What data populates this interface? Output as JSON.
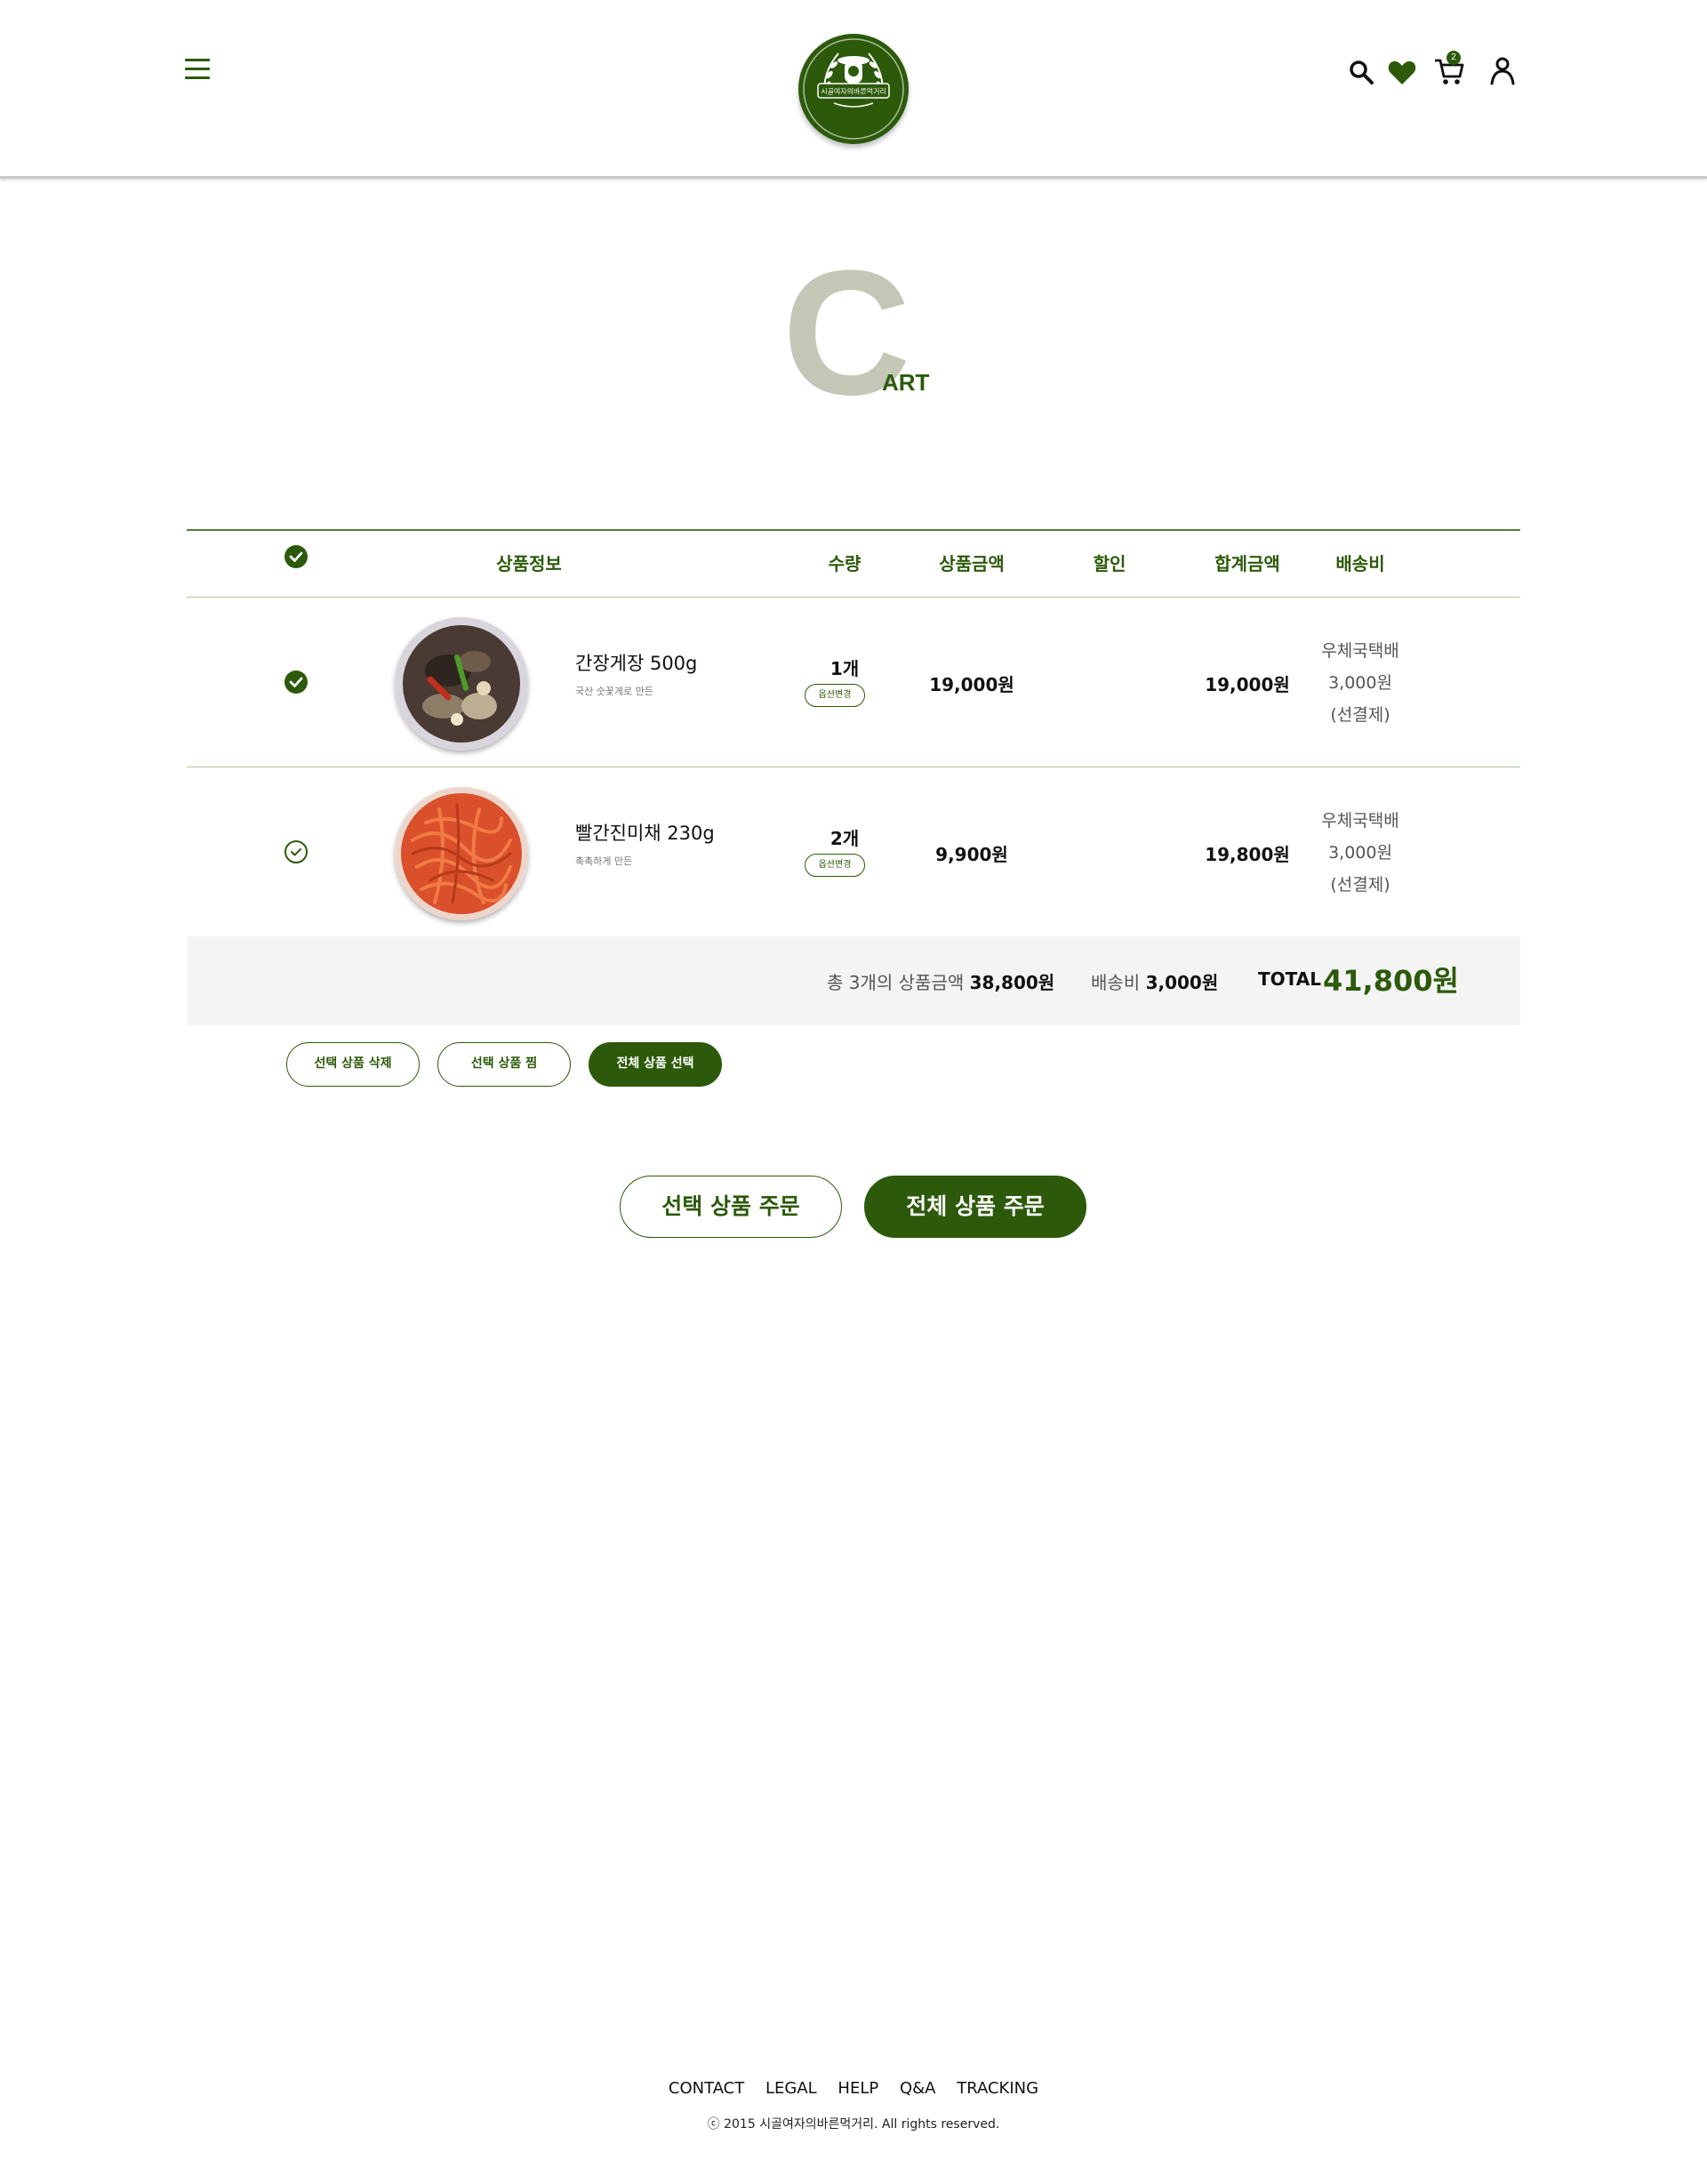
{
  "header": {
    "logo_text": "시골여자의바른먹거리",
    "cart_count": "2",
    "colors": {
      "brand": "#2c5a0a",
      "title_letter": "#c4c7b6"
    }
  },
  "title": {
    "big": "C",
    "small": "ART"
  },
  "table": {
    "headers": {
      "info": "상품정보",
      "qty": "수량",
      "price": "상품금액",
      "discount": "할인",
      "sum": "합계금액",
      "ship": "배송비"
    },
    "rows": [
      {
        "checked": true,
        "name": "간장게장 500g",
        "desc": "국산 숫꽃게로 만든",
        "qty": "1개",
        "option_label": "옵션변경",
        "price": "19,000원",
        "discount": "",
        "sum": "19,000원",
        "ship_method": "우체국택배",
        "ship_cost": "3,000원",
        "ship_note": "(선결제)"
      },
      {
        "checked": false,
        "name": "빨간진미채 230g",
        "desc": "촉촉하게 만든",
        "qty": "2개",
        "option_label": "옵션변경",
        "price": "9,900원",
        "discount": "",
        "sum": "19,800원",
        "ship_method": "우체국택배",
        "ship_cost": "3,000원",
        "ship_note": "(선결제)"
      }
    ]
  },
  "summary": {
    "count_label": "총 3개의 상품금액",
    "goods_total": "38,800원",
    "ship_label": "배송비",
    "ship_total": "3,000원",
    "total_label": "TOTAL",
    "total_value": "41,800원"
  },
  "actions": {
    "delete_selected": "선택 상품 삭제",
    "wish_selected": "선택 상품 찜",
    "select_all": "전체 상품 선택",
    "order_selected": "선택 상품 주문",
    "order_all": "전체 상품 주문"
  },
  "footer": {
    "links": [
      "CONTACT",
      "LEGAL",
      "HELP",
      "Q&A",
      "TRACKING"
    ],
    "copyright": "ⓒ 2015 시골여자의바른먹거리. All rights reserved."
  }
}
